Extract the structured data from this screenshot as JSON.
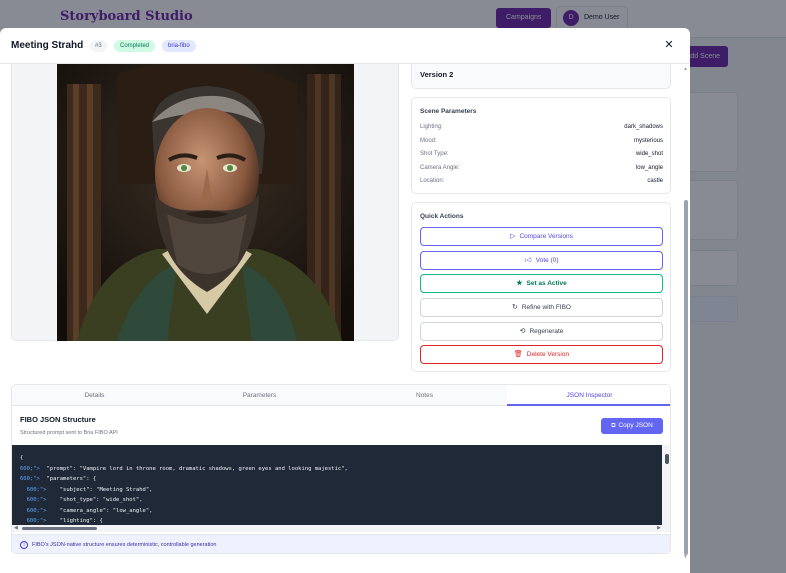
{
  "background": {
    "logo": "Storyboard Studio",
    "campaigns_label": "Campaigns",
    "user_initial": "D",
    "user_name": "Demo User",
    "add_scene_label": "Add Scene"
  },
  "modal": {
    "title": "Meeting Strahd",
    "number": "#3",
    "status": "Completed",
    "model": "bria-fibo",
    "close_icon": "close-icon"
  },
  "version": {
    "label": "Version 2"
  },
  "scene_parameters": {
    "title": "Scene Parameters",
    "rows": [
      {
        "key": "Lighting:",
        "value": "dark_shadows"
      },
      {
        "key": "Mood:",
        "value": "mysterious"
      },
      {
        "key": "Shot Type:",
        "value": "wide_shot"
      },
      {
        "key": "Camera Angle:",
        "value": "low_angle"
      },
      {
        "key": "Location:",
        "value": "castle"
      }
    ]
  },
  "quick_actions": {
    "title": "Quick Actions",
    "buttons": [
      {
        "label": "Compare Versions",
        "icon": "play-icon"
      },
      {
        "label": "Vote (0)",
        "icon": "thumbs-up-icon"
      },
      {
        "label": "Set as Active",
        "icon": "star-icon"
      },
      {
        "label": "Refine with FIBO",
        "icon": "refresh-icon"
      },
      {
        "label": "Regenerate",
        "icon": "regenerate-icon"
      },
      {
        "label": "Delete Version",
        "icon": "trash-icon"
      }
    ]
  },
  "tabs": [
    "Details",
    "Parameters",
    "Notes",
    "JSON Inspector"
  ],
  "active_tab": "JSON Inspector",
  "json_inspector": {
    "title": "FIBO JSON Structure",
    "subtitle": "Structured prompt sent to Bria FIBO API",
    "copy_label": "Copy JSON",
    "lines": [
      "{",
      "  \"prompt\": \"Vampire lord in throne room, dramatic shadows, green eyes and looking majestic\",",
      "  \"parameters\": {",
      "    \"subject\": \"Meeting Strahd\",",
      "    \"shot_type\": \"wide_shot\",",
      "    \"camera_angle\": \"low_angle\",",
      "    \"lighting\": {"
    ],
    "line_prefix": "600;\">",
    "info_text": "FIBO's JSON-native structure ensures deterministic, controllable generation"
  },
  "colors": {
    "brand": "#6b21a8",
    "accent": "#6366f1",
    "success": "#10b981",
    "danger": "#dc2626",
    "code_bg": "#1f2937"
  }
}
